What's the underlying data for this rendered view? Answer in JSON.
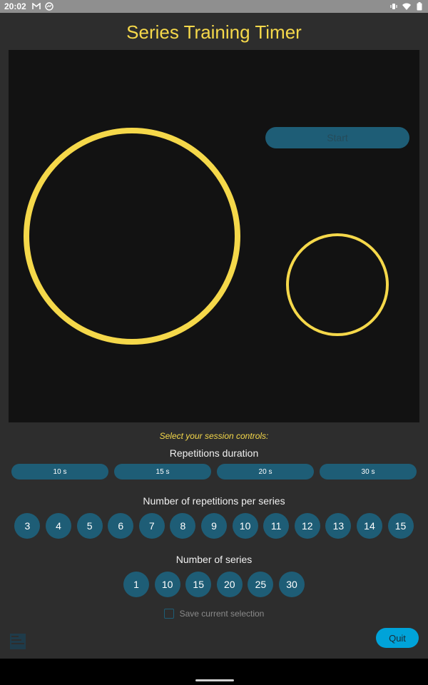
{
  "status_bar": {
    "time": "20:02",
    "left_icons": [
      "gmail-icon",
      "messenger-icon"
    ],
    "right_icons": [
      "vibrate-icon",
      "wifi-icon",
      "battery-icon"
    ]
  },
  "app": {
    "title": "Series Training Timer",
    "start_label": "Start",
    "controls_hint": "Select your session controls:",
    "duration": {
      "title": "Repetitions duration",
      "options": [
        "10 s",
        "15 s",
        "20 s",
        "30 s"
      ]
    },
    "repetitions": {
      "title": "Number of repetitions per series",
      "options": [
        "3",
        "4",
        "5",
        "6",
        "7",
        "8",
        "9",
        "10",
        "11",
        "12",
        "13",
        "14",
        "15"
      ]
    },
    "series": {
      "title": "Number of series",
      "options": [
        "1",
        "10",
        "15",
        "20",
        "25",
        "30"
      ]
    },
    "save_label": "Save current selection",
    "save_checked": false,
    "quit_label": "Quit"
  },
  "colors": {
    "accent_yellow": "#f5d84a",
    "button_teal": "#1e5d76",
    "quit_blue": "#00a3d9",
    "background": "#2d2d2d",
    "canvas": "#121212"
  }
}
